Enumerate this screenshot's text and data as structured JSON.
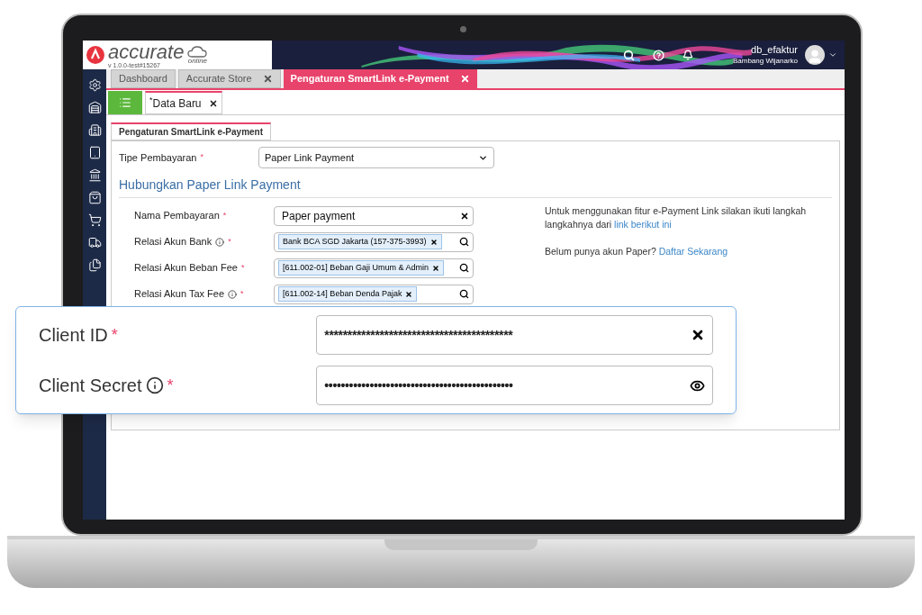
{
  "app": {
    "logo": "accurate",
    "logo_sub": "online",
    "version": "v 1.0.0-test#15267"
  },
  "user": {
    "name": "db_efaktur",
    "full_name": "Bambang Wijanarko"
  },
  "tabs": [
    {
      "label": "Dashboard",
      "selected": false,
      "closable": false
    },
    {
      "label": "Accurate Store",
      "selected": false,
      "closable": true
    },
    {
      "label": "Pengaturan SmartLink e-Payment",
      "selected": true,
      "closable": true
    }
  ],
  "subtabs": [
    {
      "label": "$^{*}$Data Baru",
      "selected": true
    }
  ],
  "form": {
    "section_tab": "Pengaturan SmartLink e-Payment",
    "payment_type": {
      "label": "Tipe Pembayaran",
      "required_mark": "*",
      "value": "Paper Link Payment"
    },
    "section_title": "Hubungkan Paper Link Payment",
    "fields": [
      {
        "kind": "text",
        "label": "Nama Pembayaran",
        "info": false,
        "required_mark": "*",
        "value": "Paper payment"
      },
      {
        "kind": "lookup",
        "label": "Relasi Akun Bank",
        "info": true,
        "required_mark": "*",
        "value": "Bank BCA SGD Jakarta (157-375-3993)"
      },
      {
        "kind": "lookup",
        "label": "Relasi Akun Beban Fee",
        "info": false,
        "required_mark": "*",
        "value": "[611.002-01] Beban Gaji Umum & Admin"
      },
      {
        "kind": "lookup",
        "label": "Relasi Akun Tax Fee",
        "info": true,
        "required_mark": "*",
        "value": "[611.002-14] Beban Denda Pajak"
      }
    ],
    "help_text": "Untuk menggunakan fitur e-Payment Link silakan ikuti langkah langkahnya dari",
    "help_link": "link berikut ini",
    "signup_text": "Belum punya akun Paper?",
    "signup_link": "Daftar Sekarang"
  },
  "callout": {
    "fields": [
      {
        "kind": "clear",
        "label": "Client ID",
        "info": false,
        "required_mark": "*",
        "value": "*****************************************"
      },
      {
        "kind": "reveal",
        "label": "Client Secret",
        "info": true,
        "required_mark": "*",
        "value": "••••••••••••••••••••••••••••••••••••••••••••••"
      }
    ]
  }
}
